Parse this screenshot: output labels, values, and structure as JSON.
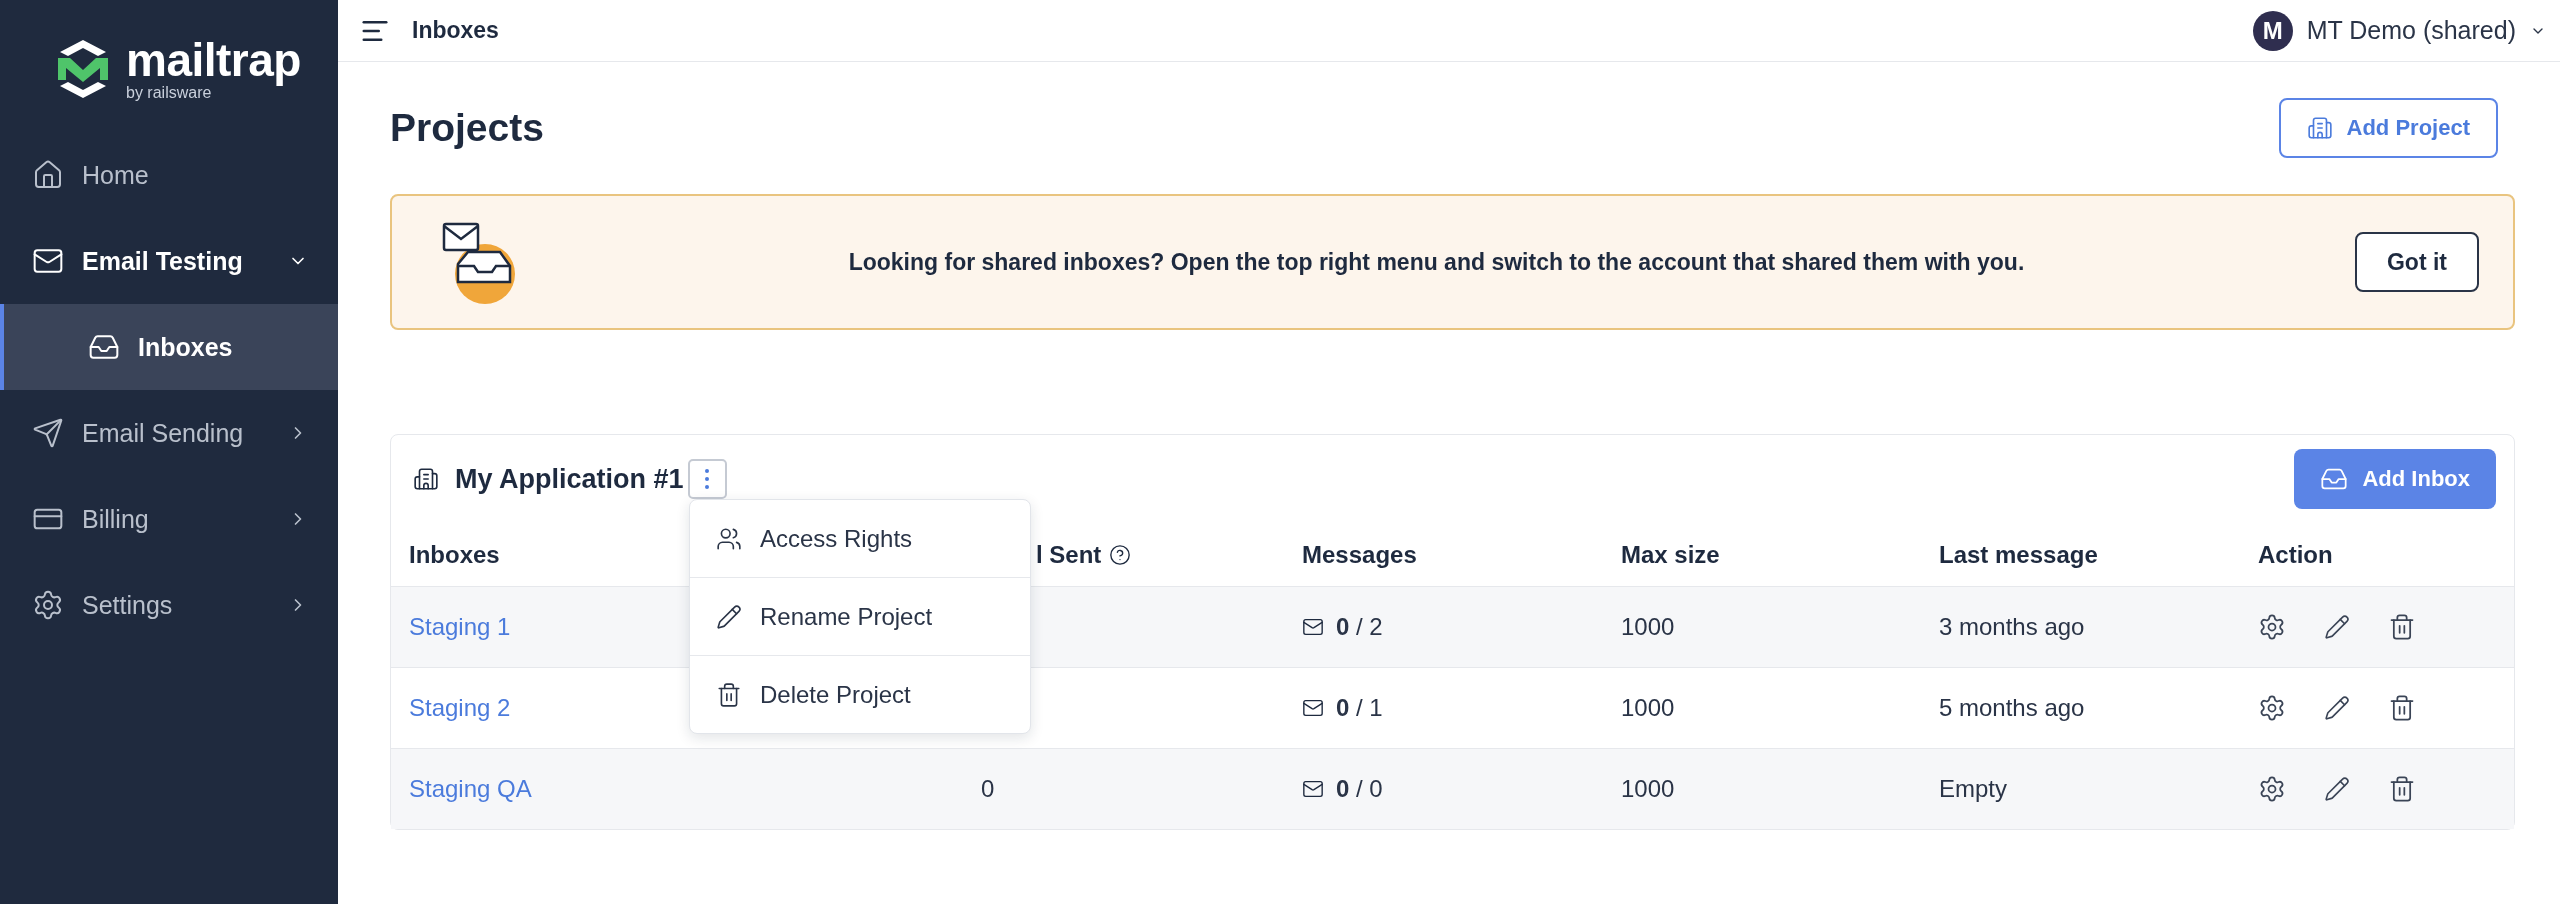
{
  "sidebar": {
    "logo": {
      "name": "mailtrap",
      "tagline": "by railsware"
    },
    "items": [
      {
        "label": "Home",
        "kind": "link",
        "selected": false
      },
      {
        "label": "Email Testing",
        "kind": "group",
        "expanded": true,
        "selected": false,
        "children": [
          {
            "label": "Inboxes",
            "selected": true
          }
        ]
      },
      {
        "label": "Email Sending",
        "kind": "group",
        "expanded": false,
        "selected": false
      },
      {
        "label": "Billing",
        "kind": "group",
        "expanded": false,
        "selected": false
      },
      {
        "label": "Settings",
        "kind": "group",
        "expanded": false,
        "selected": false
      }
    ]
  },
  "top_bar": {
    "title": "Inboxes",
    "account": {
      "initial": "M",
      "name": "MT Demo (shared)"
    }
  },
  "page": {
    "title": "Projects",
    "add_project_button": "Add Project"
  },
  "banner": {
    "text": "Looking for shared inboxes? Open the top right menu and switch to the account that shared them with you.",
    "button": "Got it"
  },
  "project": {
    "name": "My Application #1",
    "menu_open": true,
    "menu_items": [
      "Access Rights",
      "Rename Project",
      "Delete Project"
    ],
    "add_inbox_button": "Add Inbox",
    "table": {
      "columns": [
        {
          "label": "Inboxes"
        },
        {
          "label": "l Sent",
          "help": true
        },
        {
          "label": "Messages"
        },
        {
          "label": "Max size"
        },
        {
          "label": "Last message"
        },
        {
          "label": "Action"
        }
      ],
      "rows": [
        {
          "name": "Staging 1",
          "messages": "**0** / 2",
          "max_size": "1000",
          "last_message": "3 months ago"
        },
        {
          "name": "Staging 2",
          "messages": "**0** / 1",
          "max_size": "1000",
          "last_message": "5 months ago"
        },
        {
          "name": "Staging QA",
          "sent": "0",
          "messages": "**0** / 0",
          "max_size": "1000",
          "last_message": "Empty"
        }
      ]
    }
  }
}
